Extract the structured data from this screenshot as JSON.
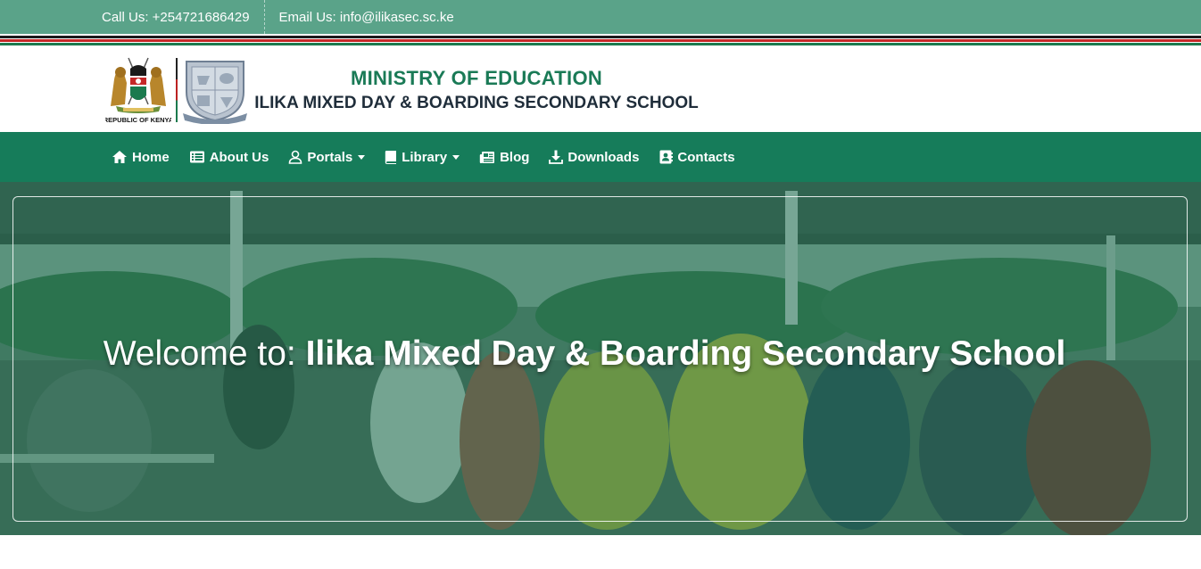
{
  "topbar": {
    "call": "Call Us: +254721686429",
    "email": "Email Us: info@ilikasec.sc.ke"
  },
  "header": {
    "ministry": "MINISTRY OF EDUCATION",
    "school": "ILIKA MIXED DAY & BOARDING SECONDARY SCHOOL",
    "kenya_caption": "REPUBLIC OF KENYA"
  },
  "nav": {
    "items": [
      {
        "label": "Home",
        "icon": "home-icon"
      },
      {
        "label": "About Us",
        "icon": "list-icon"
      },
      {
        "label": "Portals",
        "icon": "user-icon",
        "dropdown": true
      },
      {
        "label": "Library",
        "icon": "book-icon",
        "dropdown": true
      },
      {
        "label": "Blog",
        "icon": "newspaper-icon"
      },
      {
        "label": "Downloads",
        "icon": "download-icon"
      },
      {
        "label": "Contacts",
        "icon": "contact-book-icon"
      }
    ]
  },
  "hero": {
    "prefix": "Welcome to: ",
    "school_name": "Ilika Mixed Day & Boarding Secondary School"
  },
  "colors": {
    "topbar": "#5aa389",
    "nav": "#167c5a",
    "ministry_text": "#1a7a56",
    "overlay": "#1c6e50"
  }
}
